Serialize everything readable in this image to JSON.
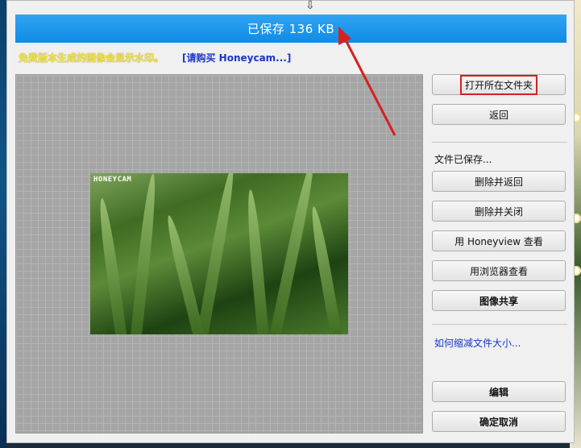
{
  "window": {
    "status_text": "已保存 136 KB",
    "notice_text": "免费版本生成的图像会显示水印。",
    "buy_link": "[请购买 Honeycam...]",
    "watermark_text": "HONEYCAM"
  },
  "sidebar": {
    "open_folder": "打开所在文件夹",
    "back": "返回",
    "saved_label": "文件已保存...",
    "delete_back": "删除并返回",
    "delete_close": "删除并关闭",
    "view_honeyview": "用 Honeyview 查看",
    "view_browser": "用浏览器查看",
    "share": "图像共享",
    "reduce_tip": "如何缩减文件大小...",
    "edit": "编辑",
    "confirm_cancel": "确定取消"
  },
  "colors": {
    "status_bar": "#1996ea",
    "notice": "#f4e64a",
    "link": "#1a36c9",
    "highlight_box": "#d62020",
    "annotation_arrow": "#d62020"
  }
}
